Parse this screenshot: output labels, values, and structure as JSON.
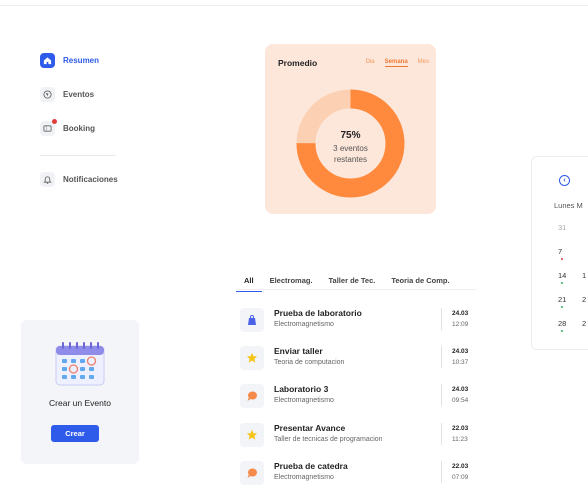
{
  "sidebar": {
    "items": [
      {
        "label": "Resumen",
        "icon": "home-icon",
        "active": true
      },
      {
        "label": "Eventos",
        "icon": "globe-icon"
      },
      {
        "label": "Booking",
        "icon": "ticket-icon",
        "badge": true
      },
      {
        "label": "Notificaciones",
        "icon": "bell-icon"
      }
    ]
  },
  "create_event": {
    "title": "Crear un Evento",
    "button_label": "Crear",
    "icon": "calendar-illustration-icon"
  },
  "promedio": {
    "title": "Promedio",
    "tabs": [
      "Dia",
      "Semana",
      "Mes"
    ],
    "active_tab": "Semana",
    "percent_label": "75%",
    "percent_value": 0.75,
    "remaining_line1": "3 eventos",
    "remaining_line2": "restantes",
    "colors": {
      "filled": "#ff8a3d",
      "empty": "#fbd0b3",
      "card": "#fde7da"
    }
  },
  "calendar": {
    "prev_icon": "chevron-left-circle-icon",
    "weekdays": [
      "Lunes",
      "M"
    ],
    "rows": [
      {
        "c1": "31",
        "c2": "",
        "muted": true
      },
      {
        "c1": "7",
        "c2": "",
        "dot": "red"
      },
      {
        "c1": "14",
        "c2": "1",
        "dot": "green"
      },
      {
        "c1": "21",
        "c2": "2",
        "dot": "green"
      },
      {
        "c1": "28",
        "c2": "2",
        "dot": "green"
      }
    ]
  },
  "tabs": [
    {
      "label": "All",
      "active": true
    },
    {
      "label": "Electromag."
    },
    {
      "label": "Taller de Tec."
    },
    {
      "label": "Teoria de Comp."
    }
  ],
  "tasks": [
    {
      "title": "Prueba de laboratorio",
      "subject": "Electromagnetismo",
      "date": "24.03",
      "time": "12:09",
      "icon": "bag-icon"
    },
    {
      "title": "Enviar taller",
      "subject": "Teoria de computacion",
      "date": "24.03",
      "time": "10:37",
      "icon": "star-icon"
    },
    {
      "title": "Laboratorio 3",
      "subject": "Electromagnetismo",
      "date": "24.03",
      "time": "09:54",
      "icon": "chat-bubble-icon"
    },
    {
      "title": "Presentar Avance",
      "subject": "Taller de tecnicas de programacion",
      "date": "22.03",
      "time": "11:23",
      "icon": "star-icon"
    },
    {
      "title": "Prueba de catedra",
      "subject": "Electromagnetismo",
      "date": "22.03",
      "time": "07:09",
      "icon": "chat-bubble-icon"
    }
  ]
}
